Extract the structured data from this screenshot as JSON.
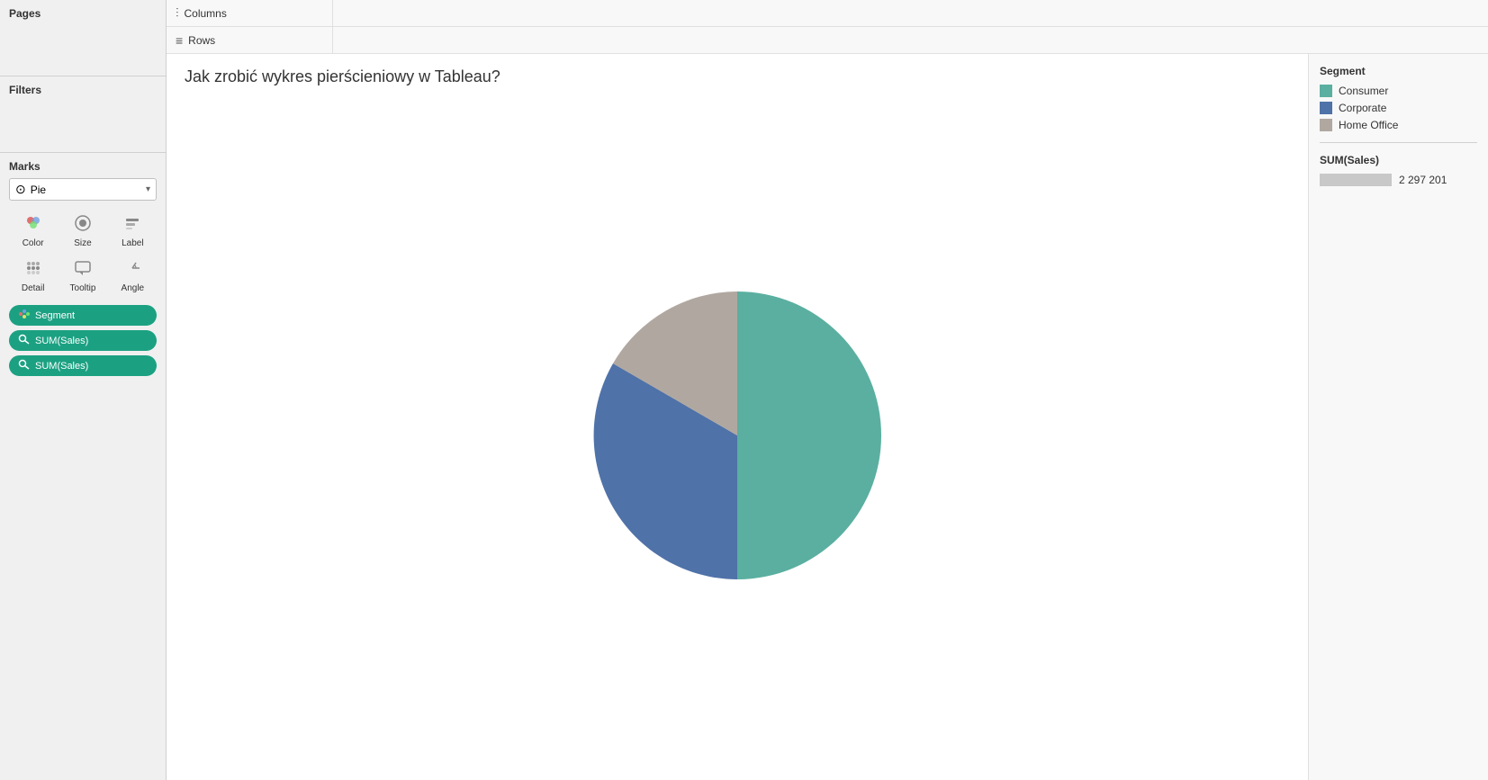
{
  "sidebar": {
    "pages_label": "Pages",
    "filters_label": "Filters",
    "marks_label": "Marks",
    "marks_type": "Pie",
    "marks_controls": [
      {
        "icon": "color",
        "label": "Color"
      },
      {
        "icon": "size",
        "label": "Size"
      },
      {
        "icon": "label",
        "label": "Label"
      },
      {
        "icon": "detail",
        "label": "Detail"
      },
      {
        "icon": "tooltip",
        "label": "Tooltip"
      },
      {
        "icon": "angle",
        "label": "Angle"
      }
    ],
    "pills": [
      {
        "icon": "dots",
        "label": "Segment"
      },
      {
        "icon": "key",
        "label": "SUM(Sales)"
      },
      {
        "icon": "key",
        "label": "SUM(Sales)"
      }
    ]
  },
  "shelf": {
    "columns_label": "Columns",
    "rows_label": "Rows"
  },
  "chart": {
    "title": "Jak zrobić wykres pierścieniowy w Tableau?",
    "pie_segments": [
      {
        "name": "Consumer",
        "color": "#5aafa0",
        "percentage": 50,
        "start_angle": -90,
        "end_angle": 90
      },
      {
        "name": "Corporate",
        "color": "#4f72a8",
        "percentage": 30,
        "start_angle": 90,
        "end_angle": 198
      },
      {
        "name": "Home Office",
        "color": "#b0a8a0",
        "percentage": 20,
        "start_angle": 198,
        "end_angle": 270
      }
    ]
  },
  "legend": {
    "segment_title": "Segment",
    "items": [
      {
        "label": "Consumer",
        "color": "#5aafa0"
      },
      {
        "label": "Corporate",
        "color": "#4f72a8"
      },
      {
        "label": "Home Office",
        "color": "#b0a8a0"
      }
    ],
    "sum_sales_title": "SUM(Sales)",
    "sum_sales_value": "2 297 201"
  }
}
